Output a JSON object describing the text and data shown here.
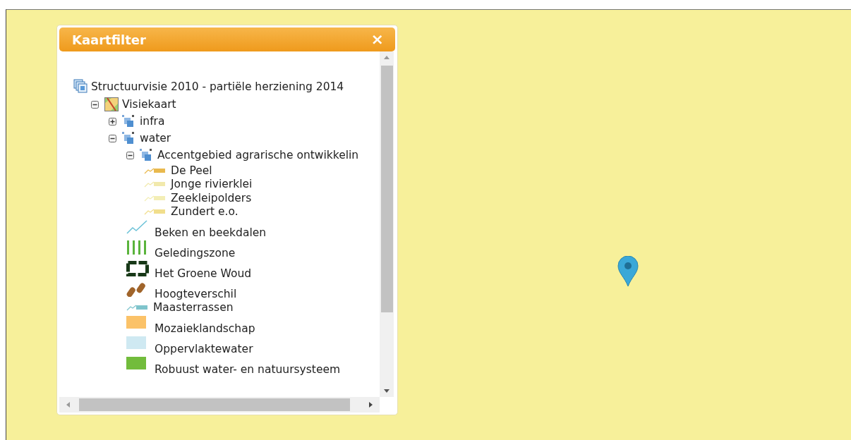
{
  "panel": {
    "title": "Kaartfilter",
    "close": "×",
    "tree": {
      "label": "Structuurvisie 2010 - partiële herziening 2014",
      "kind": "root",
      "children": [
        {
          "label": "Visiekaart",
          "kind": "map",
          "expanded": true,
          "children": [
            {
              "label": "infra",
              "kind": "layer",
              "expanded": false
            },
            {
              "label": "water",
              "kind": "layer",
              "expanded": true,
              "children": [
                {
                  "label": "Accentgebied agrarische ontwikkelin",
                  "kind": "layer",
                  "expanded": true,
                  "children": [
                    {
                      "label": "De Peel",
                      "kind": "linefill",
                      "color": "#e9b94e"
                    },
                    {
                      "label": "Jonge rivierklei",
                      "kind": "linefill",
                      "color": "#f1e9ac"
                    },
                    {
                      "label": "Zeekleipolders",
                      "kind": "linefill",
                      "color": "#f3eeb6"
                    },
                    {
                      "label": "Zundert e.o.",
                      "kind": "linefill",
                      "color": "#f1de8c"
                    }
                  ]
                },
                {
                  "label": "Beken en beekdalen",
                  "kind": "line",
                  "color": "#6ec3d8"
                },
                {
                  "label": "Geledingszone",
                  "kind": "stripes",
                  "color": "#5ab43c"
                },
                {
                  "label": "Het Groene Woud",
                  "kind": "frame",
                  "color": "#173817"
                },
                {
                  "label": "Hoogteverschil",
                  "kind": "blobs",
                  "color": "#a0642a"
                },
                {
                  "label": "Maasterrassen",
                  "kind": "linefill",
                  "color": "#7fc4cc"
                },
                {
                  "label": "Mozaieklandschap",
                  "kind": "fill",
                  "color": "#fbc268"
                },
                {
                  "label": "Oppervlaktewater",
                  "kind": "fill",
                  "color": "#cfe9f2"
                },
                {
                  "label": "Robuust water- en natuursysteem",
                  "kind": "fill",
                  "color": "#72bc3c"
                }
              ]
            }
          ]
        }
      ]
    }
  }
}
